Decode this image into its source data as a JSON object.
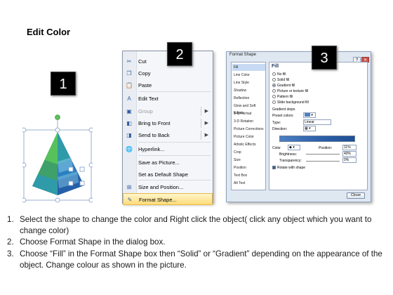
{
  "title": "Edit Color",
  "badges": [
    "1",
    "2",
    "3"
  ],
  "context_menu": {
    "items": [
      {
        "label": "Cut",
        "icon": "scissors-icon",
        "glyph": "✂",
        "enabled": true,
        "submenu": false
      },
      {
        "label": "Copy",
        "icon": "copy-icon",
        "glyph": "❐",
        "enabled": true,
        "submenu": false
      },
      {
        "label": "Paste",
        "icon": "paste-icon",
        "glyph": "📋",
        "enabled": true,
        "submenu": false
      },
      {
        "label": "Edit Text",
        "icon": "edit-text-icon",
        "glyph": "A",
        "enabled": true,
        "submenu": false
      },
      {
        "label": "Group",
        "icon": "group-icon",
        "glyph": "▣",
        "enabled": false,
        "submenu": true
      },
      {
        "label": "Bring to Front",
        "icon": "bring-front-icon",
        "glyph": "◧",
        "enabled": true,
        "submenu": true
      },
      {
        "label": "Send to Back",
        "icon": "send-back-icon",
        "glyph": "◨",
        "enabled": true,
        "submenu": true
      },
      {
        "label": "Hyperlink...",
        "icon": "hyperlink-icon",
        "glyph": "🌐",
        "enabled": true,
        "submenu": false
      },
      {
        "label": "Save as Picture...",
        "icon": "",
        "glyph": "",
        "enabled": true,
        "submenu": false
      },
      {
        "label": "Set as Default Shape",
        "icon": "",
        "glyph": "",
        "enabled": true,
        "submenu": false
      },
      {
        "label": "Size and Position...",
        "icon": "size-position-icon",
        "glyph": "⊞",
        "enabled": true,
        "submenu": false
      },
      {
        "label": "Format Shape...",
        "icon": "format-shape-icon",
        "glyph": "✎",
        "enabled": true,
        "submenu": false,
        "highlighted": true
      }
    ]
  },
  "format_dialog": {
    "title": "Format Shape",
    "nav": [
      "Fill",
      "Line Color",
      "Line Style",
      "Shadow",
      "Reflection",
      "Glow and Soft Edges",
      "3-D Format",
      "3-D Rotation",
      "Picture Corrections",
      "Picture Color",
      "Artistic Effects",
      "Crop",
      "Size",
      "Position",
      "Text Box",
      "Alt Text"
    ],
    "pane_title": "Fill",
    "fill_options": [
      "No fill",
      "Solid fill",
      "Gradient fill",
      "Picture or texture fill",
      "Pattern fill",
      "Slide background fill"
    ],
    "selected_fill": "Gradient fill",
    "preset_label": "Preset colors:",
    "type_label": "Type:",
    "type_value": "Linear",
    "direction_label": "Direction:",
    "angle_label": "Angle:",
    "angle_value": "90°",
    "gradient_stops_label": "Gradient stops",
    "color_label": "Color",
    "position_label": "Position:",
    "position_value": "11%",
    "brightness_label": "Brightness:",
    "brightness_value": "40%",
    "transparency_label": "Transparency:",
    "transparency_value": "0%",
    "rotate_label": "Rotate with shape",
    "close_label": "Close"
  },
  "steps": [
    {
      "num": "1.",
      "text": "Select the shape to change the color and Right click the object( click any object which you want to change color)"
    },
    {
      "num": "2.",
      "text": "Choose Format Shape in the dialog box."
    },
    {
      "num": "3.",
      "text": "Choose “Fill” in the Format Shape box then “Solid” or “Gradient” depending on the appearance of the object. Change colour as shown in the picture."
    }
  ],
  "colors": {
    "pyramid_green": "#3aa84b",
    "pyramid_teal": "#2f9aa8",
    "pyramid_blue": "#2b6fb8",
    "highlight": "#ffdc79",
    "gradient_blue": "#2b5fa8"
  }
}
